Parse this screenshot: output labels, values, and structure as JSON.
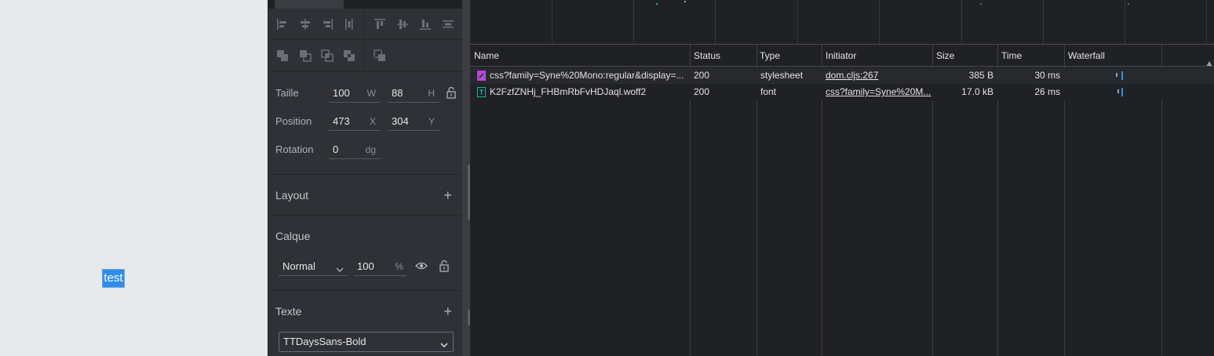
{
  "canvas": {
    "selected_text": "test"
  },
  "design": {
    "measures": {
      "size_label": "Taille",
      "width_value": "100",
      "width_unit": "W",
      "height_value": "88",
      "height_unit": "H",
      "position_label": "Position",
      "x_value": "473",
      "x_unit": "X",
      "y_value": "304",
      "y_unit": "Y",
      "rotation_label": "Rotation",
      "rotation_value": "0",
      "rotation_unit": "dg"
    },
    "layout": {
      "title": "Layout",
      "add": "+"
    },
    "layer": {
      "title": "Calque",
      "blend_mode": "Normal",
      "opacity_value": "100",
      "opacity_unit": "%"
    },
    "text": {
      "title": "Texte",
      "add": "+",
      "font_family": "TTDaysSans-Bold"
    }
  },
  "network": {
    "columns": [
      "Name",
      "Status",
      "Type",
      "Initiator",
      "Size",
      "Time",
      "Waterfall"
    ],
    "rows": [
      {
        "icon": "stylesheet-file-icon",
        "name": "css?family=Syne%20Mono:regular&display=...",
        "status": "200",
        "type": "stylesheet",
        "initiator": "dom.cljs:267",
        "size": "385 B",
        "time": "30 ms"
      },
      {
        "icon": "font-file-icon",
        "name": "K2FzfZNHj_FHBmRbFvHDJaql.woff2",
        "status": "200",
        "type": "font",
        "initiator": "css?family=Syne%20M...",
        "size": "17.0 kB",
        "time": "26 ms"
      }
    ]
  },
  "colors": {
    "selection": "#2e8ded",
    "waterfall_wait": "#9aa0a6",
    "waterfall_download": "#1a9bef",
    "stylesheet_icon": "#b04bd8",
    "font_icon": "#1ab6a8"
  }
}
